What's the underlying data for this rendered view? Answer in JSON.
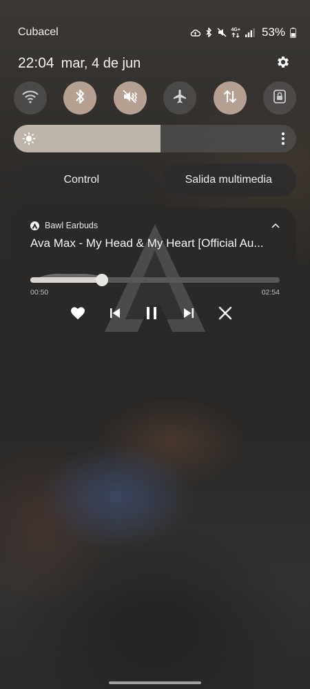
{
  "status_bar": {
    "carrier": "Cubacel",
    "network_label": "4G+",
    "battery_percent_text": "53%",
    "icons": [
      "cloud-sync-icon",
      "bluetooth-icon",
      "mute-icon",
      "network-4g-icon",
      "signal-icon",
      "battery-icon"
    ]
  },
  "header": {
    "time": "22:04",
    "date": "mar, 4 de jun",
    "settings_icon": "gear-icon"
  },
  "quick_toggles": [
    {
      "name": "wifi",
      "icon": "wifi-icon",
      "state": "off"
    },
    {
      "name": "bluetooth",
      "icon": "bluetooth-icon",
      "state": "on"
    },
    {
      "name": "sound",
      "icon": "mute-icon",
      "state": "on"
    },
    {
      "name": "airplane",
      "icon": "airplane-icon",
      "state": "off"
    },
    {
      "name": "mobile-data",
      "icon": "data-transfer-icon",
      "state": "on"
    },
    {
      "name": "rotation-lock",
      "icon": "lock-icon",
      "state": "off"
    }
  ],
  "brightness": {
    "level": 0.52
  },
  "shortcuts": {
    "control_label": "Control",
    "media_output_label": "Salida multimedia"
  },
  "media": {
    "app_name": "Bawl Earbuds",
    "title": "Ava Max - My Head & My Heart [Official Au...",
    "elapsed": "00:50",
    "duration": "02:54",
    "progress": 0.287
  },
  "colors": {
    "toggle_on": "#b6a092",
    "toggle_off": "#504e4c",
    "brightness_fill": "#bdb5aa",
    "card_bg": "#2a2928"
  }
}
